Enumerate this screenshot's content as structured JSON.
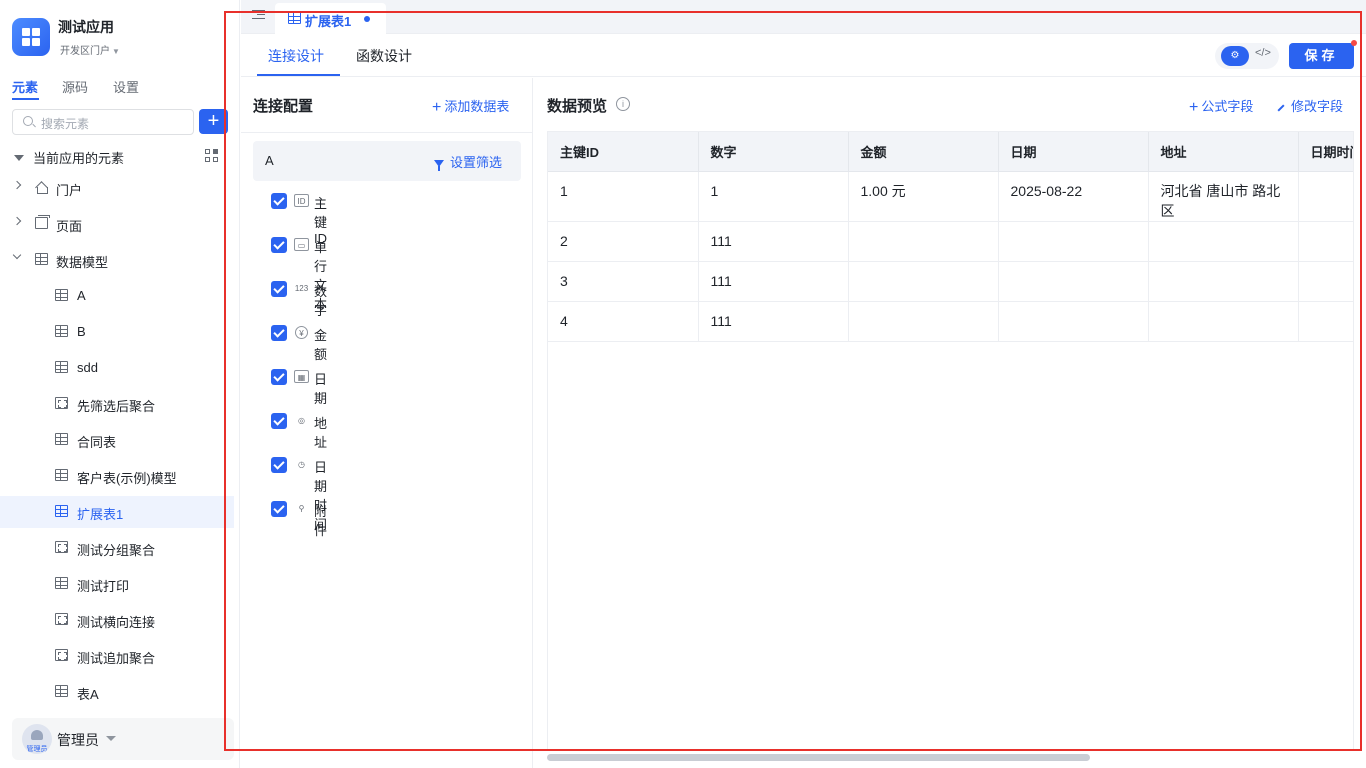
{
  "app": {
    "name": "测试应用",
    "portal": "开发区门户"
  },
  "sidebar": {
    "tabs": [
      {
        "label": "元素"
      },
      {
        "label": "源码"
      },
      {
        "label": "设置"
      }
    ],
    "search_placeholder": "搜索元素",
    "add_label": "+",
    "tree_header": "当前应用的元素",
    "top_items": [
      {
        "label": "门户",
        "icon": "home-icon"
      },
      {
        "label": "页面",
        "icon": "page-icon"
      },
      {
        "label": "数据模型",
        "icon": "table-icon"
      }
    ],
    "models": [
      {
        "label": "A",
        "icon": "table-icon"
      },
      {
        "label": "B",
        "icon": "table-icon"
      },
      {
        "label": "sdd",
        "icon": "table-icon"
      },
      {
        "label": "先筛选后聚合",
        "icon": "aggregate-icon"
      },
      {
        "label": "合同表",
        "icon": "table-icon"
      },
      {
        "label": "客户表(示例)模型",
        "icon": "table-icon"
      },
      {
        "label": "扩展表1",
        "icon": "table-icon",
        "selected": true
      },
      {
        "label": "测试分组聚合",
        "icon": "aggregate-icon"
      },
      {
        "label": "测试打印",
        "icon": "table-icon"
      },
      {
        "label": "测试横向连接",
        "icon": "aggregate-icon"
      },
      {
        "label": "测试追加聚合",
        "icon": "aggregate-icon"
      },
      {
        "label": "表A",
        "icon": "table-icon"
      }
    ],
    "user": {
      "name": "管理员",
      "badge": "管理员"
    }
  },
  "tabbar": {
    "doc_tab": "扩展表1"
  },
  "subtabs": [
    {
      "label": "连接设计"
    },
    {
      "label": "函数设计"
    }
  ],
  "toolbar": {
    "mode_on": "⚙",
    "mode_off": "</>",
    "save_label": "保存"
  },
  "config": {
    "title": "连接配置",
    "add_table": "添加数据表",
    "table_name": "A",
    "set_filter": "设置筛选",
    "fields": [
      {
        "label": "主键ID",
        "icon": "ID"
      },
      {
        "label": "单行文本",
        "icon": "▭"
      },
      {
        "label": "数字",
        "icon": "123"
      },
      {
        "label": "金额",
        "icon": "¥"
      },
      {
        "label": "日期",
        "icon": "▦"
      },
      {
        "label": "地址",
        "icon": "◎"
      },
      {
        "label": "日期时间",
        "icon": "◷"
      },
      {
        "label": "附件",
        "icon": "⚲"
      }
    ]
  },
  "preview": {
    "title": "数据预览",
    "formula_field": "公式字段",
    "edit_field": "修改字段",
    "columns": [
      "主键ID",
      "数字",
      "金额",
      "日期",
      "地址",
      "日期时间"
    ],
    "rows": [
      [
        "1",
        "1",
        "1.00 元",
        "2025-08-22",
        "河北省 唐山市 路北区",
        ""
      ],
      [
        "2",
        "111",
        "",
        "",
        "",
        ""
      ],
      [
        "3",
        "111",
        "",
        "",
        "",
        ""
      ],
      [
        "4",
        "111",
        "",
        "",
        "",
        ""
      ]
    ]
  },
  "colors": {
    "accent": "#2b63f0",
    "highlight_frame": "#e8302b"
  }
}
